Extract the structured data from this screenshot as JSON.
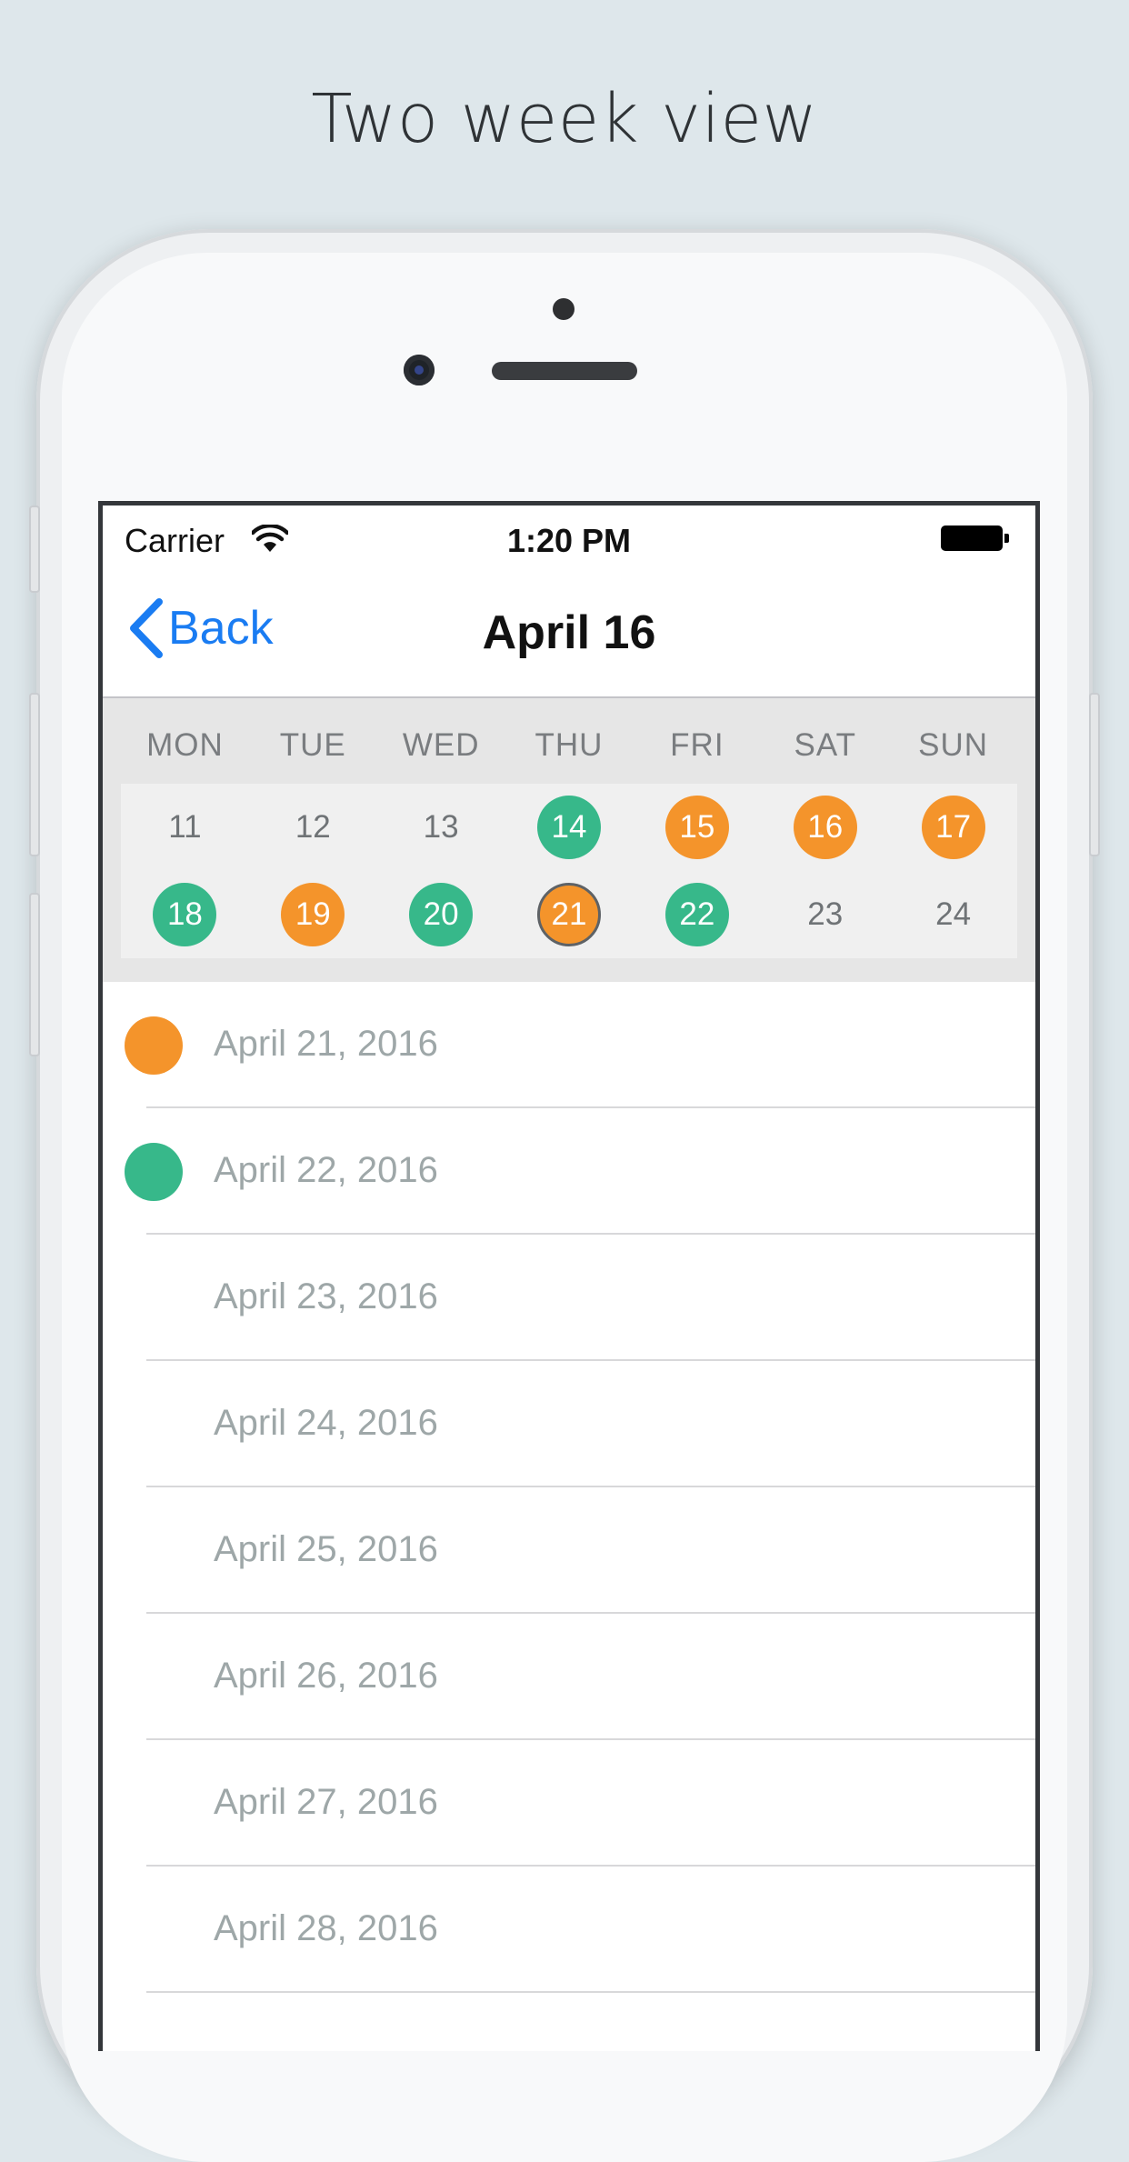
{
  "promo": {
    "title": "Two week view"
  },
  "status_bar": {
    "carrier": "Carrier",
    "time": "1:20 PM"
  },
  "nav": {
    "back_label": "Back",
    "title": "April 16"
  },
  "colors": {
    "green": "#37b88a",
    "orange": "#f4942b",
    "accent": "#1a7cf2"
  },
  "calendar": {
    "weekdays": [
      "MON",
      "TUE",
      "WED",
      "THU",
      "FRI",
      "SAT",
      "SUN"
    ],
    "weeks": [
      [
        {
          "day": "11",
          "status": "none"
        },
        {
          "day": "12",
          "status": "none"
        },
        {
          "day": "13",
          "status": "none"
        },
        {
          "day": "14",
          "status": "green"
        },
        {
          "day": "15",
          "status": "orange"
        },
        {
          "day": "16",
          "status": "orange"
        },
        {
          "day": "17",
          "status": "orange"
        }
      ],
      [
        {
          "day": "18",
          "status": "green"
        },
        {
          "day": "19",
          "status": "orange"
        },
        {
          "day": "20",
          "status": "green"
        },
        {
          "day": "21",
          "status": "orange",
          "selected": true
        },
        {
          "day": "22",
          "status": "green"
        },
        {
          "day": "23",
          "status": "none"
        },
        {
          "day": "24",
          "status": "none"
        }
      ]
    ]
  },
  "list": {
    "rows": [
      {
        "date": "April 21, 2016",
        "status": "orange"
      },
      {
        "date": "April 22, 2016",
        "status": "green"
      },
      {
        "date": "April 23, 2016",
        "status": "none"
      },
      {
        "date": "April 24, 2016",
        "status": "none"
      },
      {
        "date": "April 25, 2016",
        "status": "none"
      },
      {
        "date": "April 26, 2016",
        "status": "none"
      },
      {
        "date": "April 27, 2016",
        "status": "none"
      },
      {
        "date": "April 28, 2016",
        "status": "none"
      }
    ]
  }
}
